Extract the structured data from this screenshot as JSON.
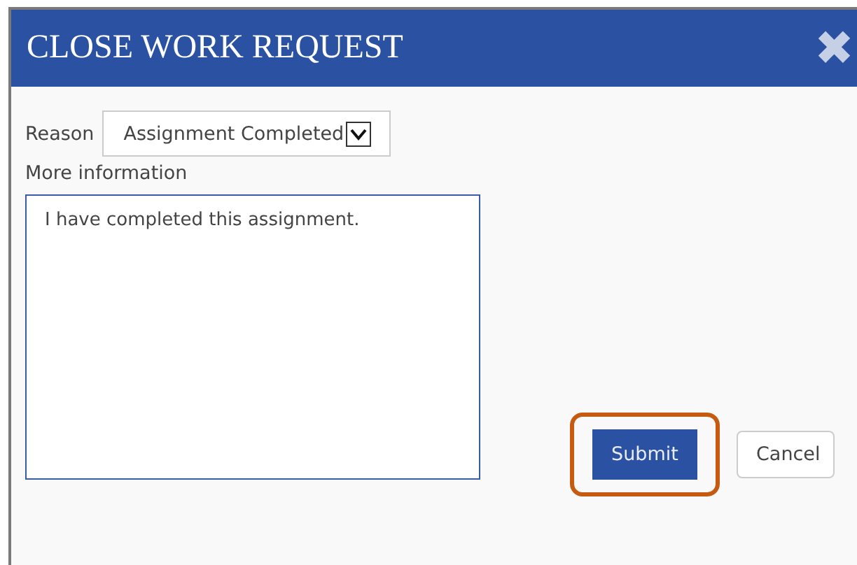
{
  "dialog": {
    "title": "CLOSE WORK REQUEST",
    "close": "✖"
  },
  "reason": {
    "label": "Reason",
    "value": "Assignment Completed"
  },
  "more_information": {
    "label": "More information",
    "value": "I have completed this assignment."
  },
  "buttons": [
    {
      "label": "Submit",
      "kind": "primary",
      "highlighted": true
    },
    {
      "label": "Cancel",
      "kind": "secondary",
      "highlighted": false
    }
  ]
}
